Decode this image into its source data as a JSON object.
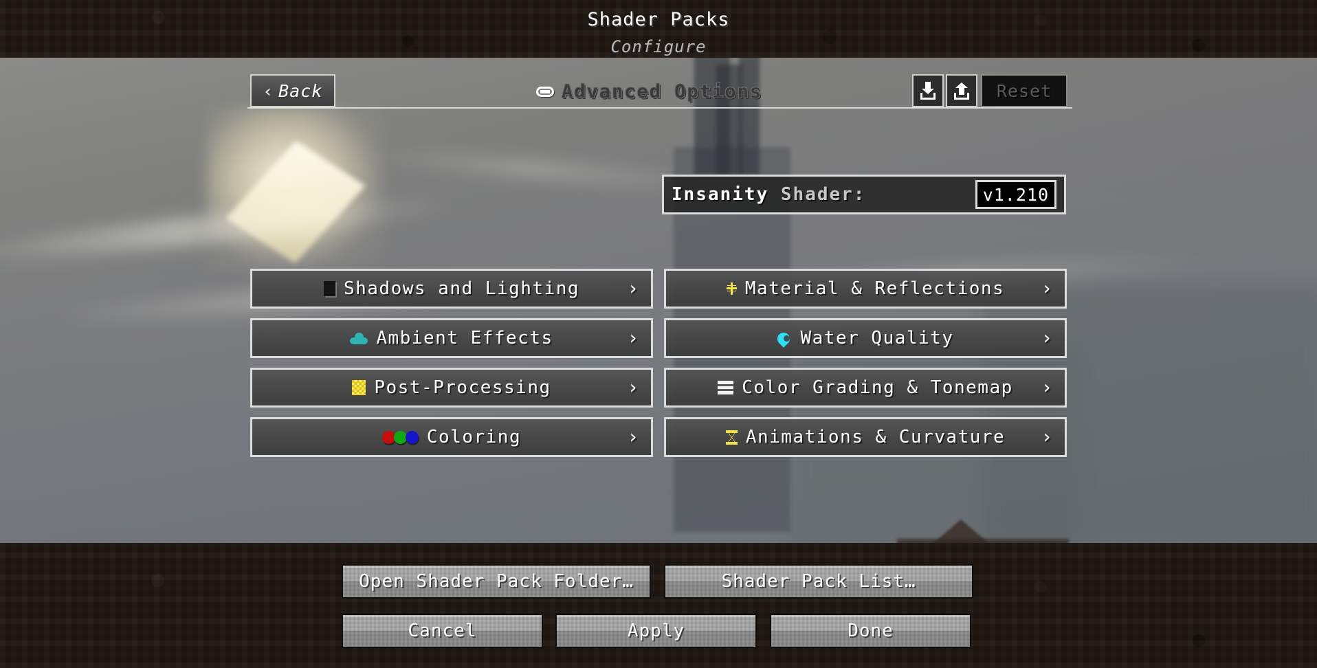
{
  "header": {
    "title": "Shader Packs",
    "subtitle": "Configure"
  },
  "toolbar": {
    "back_chevron": "‹",
    "back_label": "Back",
    "section_title": "Advanced Options",
    "section_icon": "slider-icon",
    "import_icon": "import-download-icon",
    "export_icon": "export-upload-icon",
    "reset_label": "Reset"
  },
  "shader": {
    "name_bold": "Insanity",
    "name_rest": " Shader:",
    "version": "v1.210"
  },
  "categories": [
    {
      "label": "Shadows and Lighting",
      "icon": "shadow-block-icon",
      "chevron": "›",
      "column": "left"
    },
    {
      "label": "Material & Reflections",
      "icon": "sparkle-icon",
      "chevron": "›",
      "column": "right"
    },
    {
      "label": "Ambient Effects",
      "icon": "cloud-icon",
      "chevron": "›",
      "column": "left"
    },
    {
      "label": "Water Quality",
      "icon": "water-drop-icon",
      "chevron": "›",
      "column": "right"
    },
    {
      "label": "Post-Processing",
      "icon": "checker-grid-icon",
      "chevron": "›",
      "column": "left"
    },
    {
      "label": "Color Grading & Tonemap",
      "icon": "film-strip-icon",
      "chevron": "›",
      "column": "right"
    },
    {
      "label": "Coloring",
      "icon": "rgb-circles-icon",
      "chevron": "›",
      "column": "left"
    },
    {
      "label": "Animations & Curvature",
      "icon": "hourglass-icon",
      "chevron": "›",
      "column": "right"
    }
  ],
  "footer": {
    "open_folder_label": "Open Shader Pack Folder…",
    "pack_list_label": "Shader Pack List…",
    "cancel_label": "Cancel",
    "apply_label": "Apply",
    "done_label": "Done"
  },
  "colors": {
    "text_white": "#ffffff",
    "subtitle_gray": "#b9b9b9",
    "border_light": "#dcdcdc",
    "panel_dark": "#3f3f3f",
    "stone_button": "#9c9c9c",
    "dirt": "#2b2018",
    "reset_disabled_text": "#5b5b5b",
    "accent_cyan": "#2fe0f5",
    "accent_teal": "#2fb4b4",
    "accent_yellow": "#f2e24a",
    "rgb_red": "#c40f0f",
    "rgb_green": "#12a812",
    "rgb_blue": "#1414c8"
  }
}
